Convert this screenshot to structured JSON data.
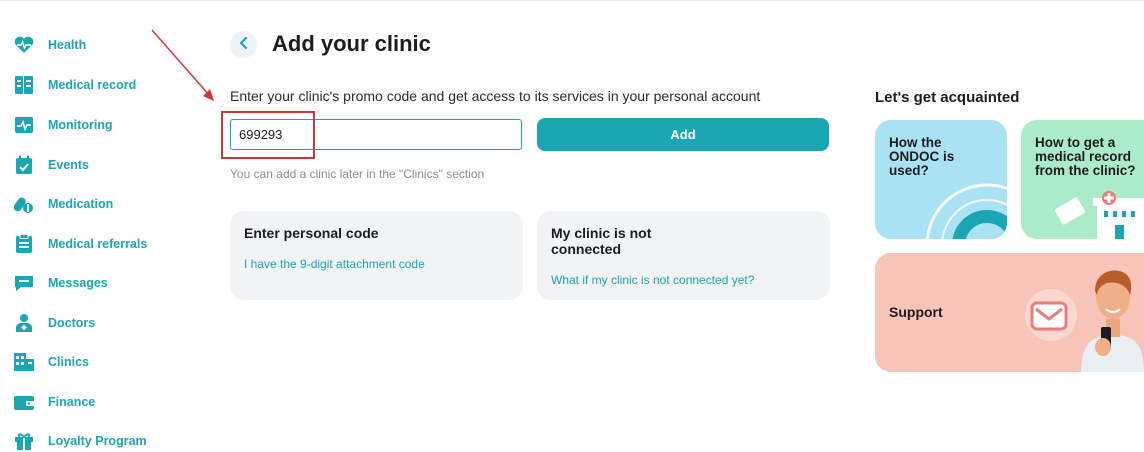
{
  "sidebar": {
    "items": [
      {
        "label": "Health",
        "icon": "heart-pulse-icon"
      },
      {
        "label": "Medical record",
        "icon": "medical-record-icon"
      },
      {
        "label": "Monitoring",
        "icon": "monitoring-icon"
      },
      {
        "label": "Events",
        "icon": "calendar-icon"
      },
      {
        "label": "Medication",
        "icon": "pills-icon"
      },
      {
        "label": "Medical referrals",
        "icon": "referral-clipboard-icon"
      },
      {
        "label": "Messages",
        "icon": "chat-icon"
      },
      {
        "label": "Doctors",
        "icon": "doctor-icon"
      },
      {
        "label": "Clinics",
        "icon": "clinic-building-icon"
      },
      {
        "label": "Finance",
        "icon": "wallet-icon"
      },
      {
        "label": "Loyalty Program",
        "icon": "gift-icon"
      }
    ]
  },
  "main": {
    "title": "Add your clinic",
    "instruction": "Enter your clinic's promo code and get access to its services in your personal account",
    "promo_input": {
      "value": "699293",
      "placeholder": ""
    },
    "add_label": "Add",
    "hint": "You can add a clinic later in the \"Clinics\" section",
    "cards": [
      {
        "title": "Enter personal code",
        "link": "I have the 9-digit attachment code"
      },
      {
        "title": "My clinic is not connected",
        "link": "What if my clinic is not connected yet?"
      }
    ]
  },
  "acquaint": {
    "title": "Let's get acquainted",
    "tiles": [
      {
        "text": "How the ONDOC is used?"
      },
      {
        "text": "How to get a medical record from the clinic?"
      },
      {
        "text": "Support"
      }
    ]
  },
  "colors": {
    "accent": "#1ba6b4",
    "annotation": "#d0373a",
    "tile_blue": "#a9e3f3",
    "tile_green": "#a9ecc7",
    "tile_pink": "#f8c3b8"
  }
}
